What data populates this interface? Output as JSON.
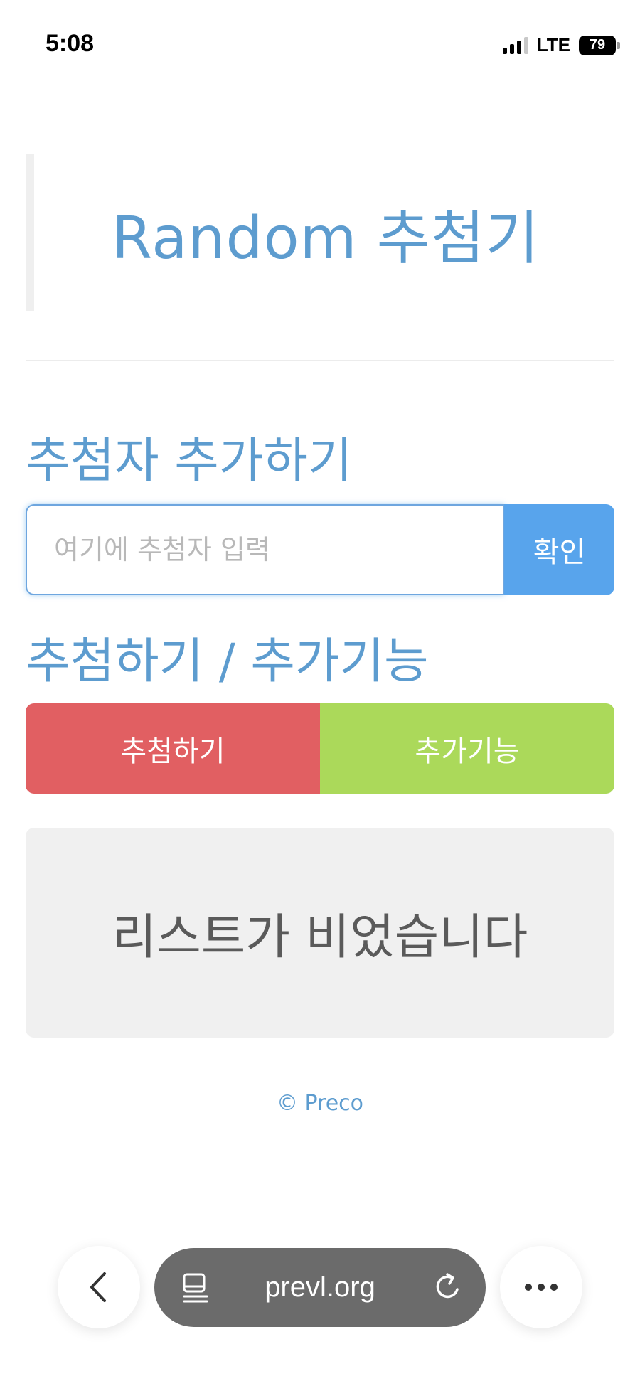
{
  "status_bar": {
    "time": "5:08",
    "network": "LTE",
    "battery": "79"
  },
  "header": {
    "title": "Random 추첨기"
  },
  "add_section": {
    "heading": "추첨자 추가하기",
    "input_placeholder": "여기에 추첨자 입력",
    "input_value": "",
    "confirm_label": "확인"
  },
  "draw_section": {
    "heading": "추첨하기 / 추가기능",
    "draw_label": "추첨하기",
    "extra_label": "추가기능"
  },
  "list": {
    "empty_message": "리스트가 비었습니다"
  },
  "footer": {
    "text": "© Preco"
  },
  "browser": {
    "url": "prevl.org",
    "icons": [
      "back-icon",
      "tab-icon",
      "reload-icon",
      "more-icon"
    ]
  },
  "colors": {
    "accent": "#5d9ccf",
    "confirm": "#58a4ec",
    "draw": "#e15f62",
    "extra": "#abd95a",
    "panel": "#f0f0f0"
  }
}
